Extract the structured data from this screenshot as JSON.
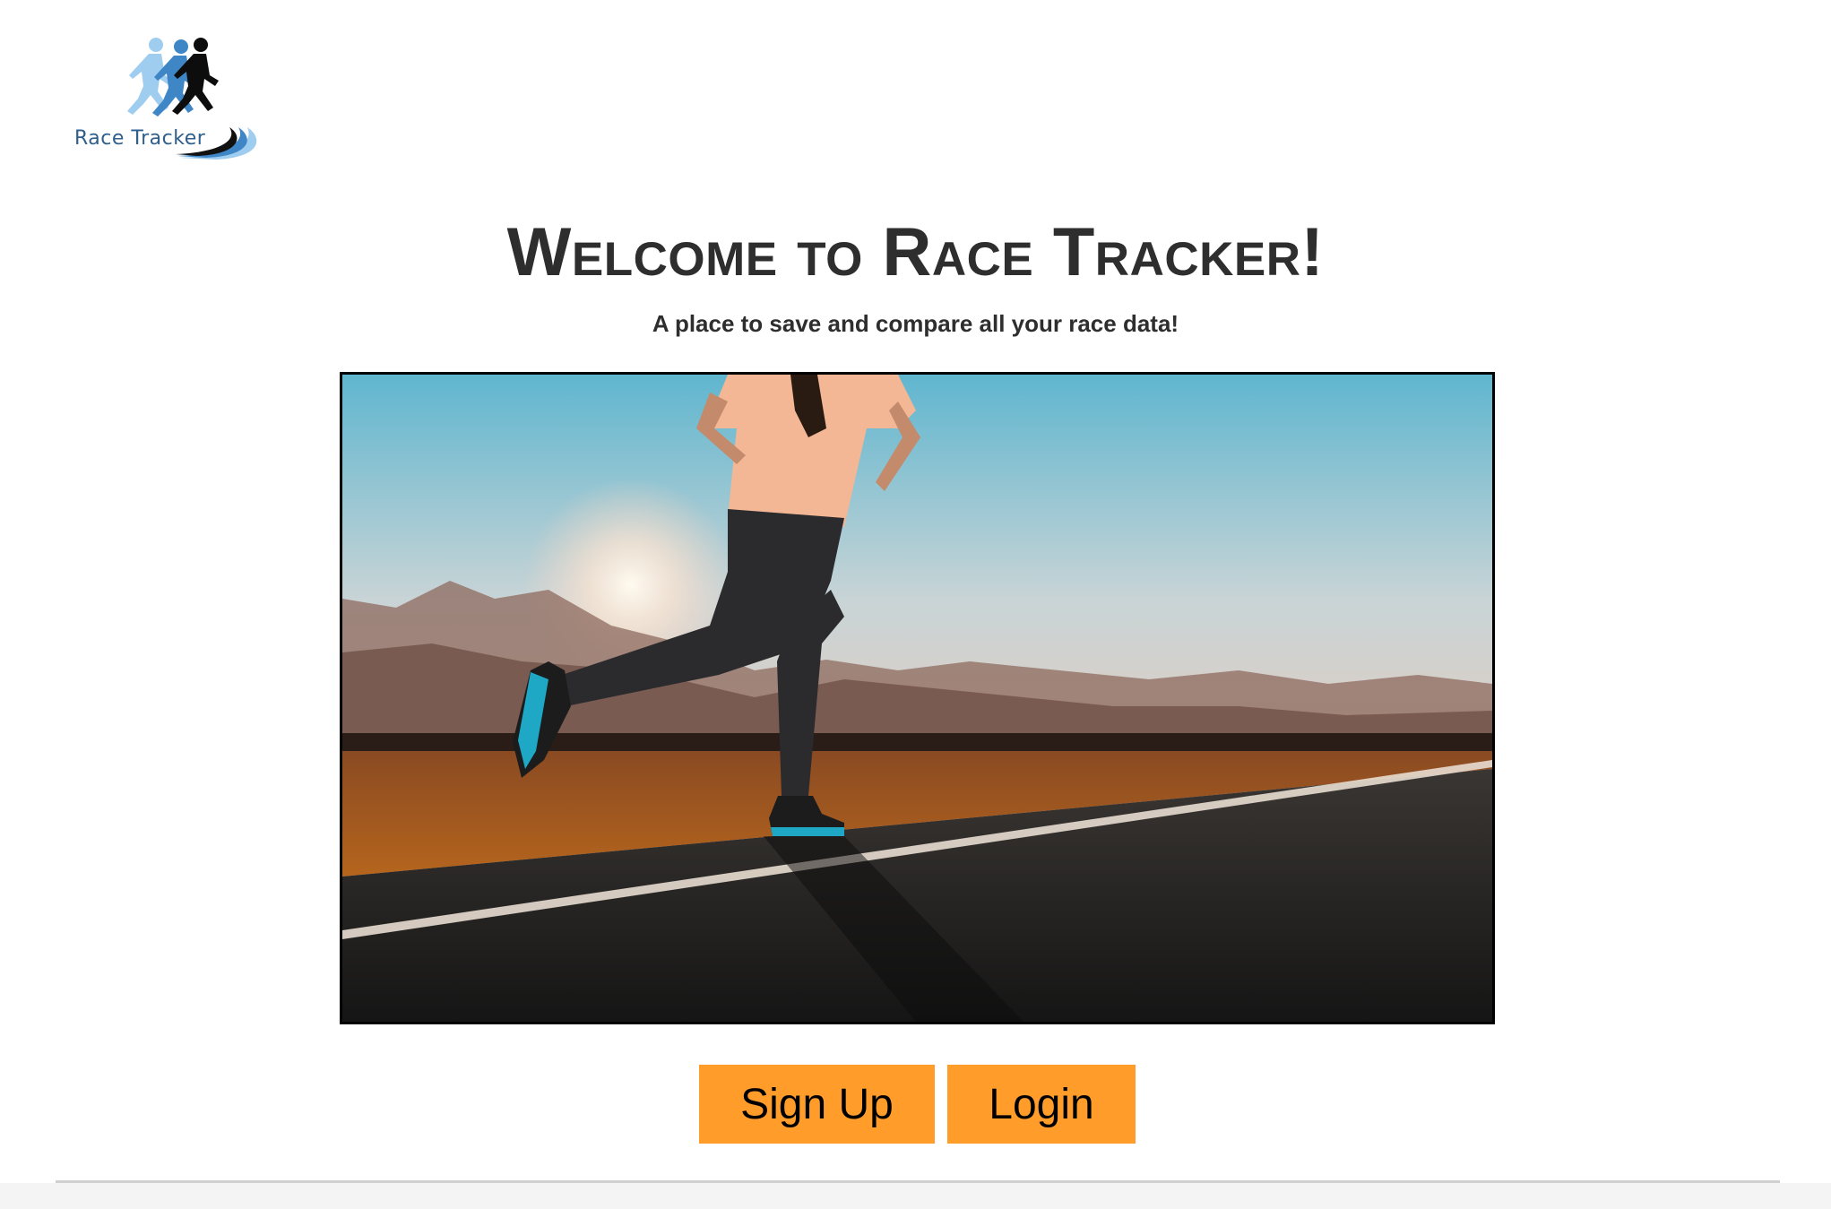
{
  "logo": {
    "text": "Race Tracker",
    "icon": "runners-logo-icon"
  },
  "header": {
    "title": "Welcome to Race Tracker!",
    "subtitle": "A place to save and compare all your race data!"
  },
  "hero": {
    "icon": "runner-photo"
  },
  "buttons": {
    "signup_label": "Sign Up",
    "login_label": "Login"
  },
  "colors": {
    "button_bg": "#ff9c2a",
    "heading_text": "#2e2e2e",
    "logo_blue_light": "#8fc3ec",
    "logo_blue_mid": "#3f86c7",
    "logo_text": "#2f5f8c"
  }
}
